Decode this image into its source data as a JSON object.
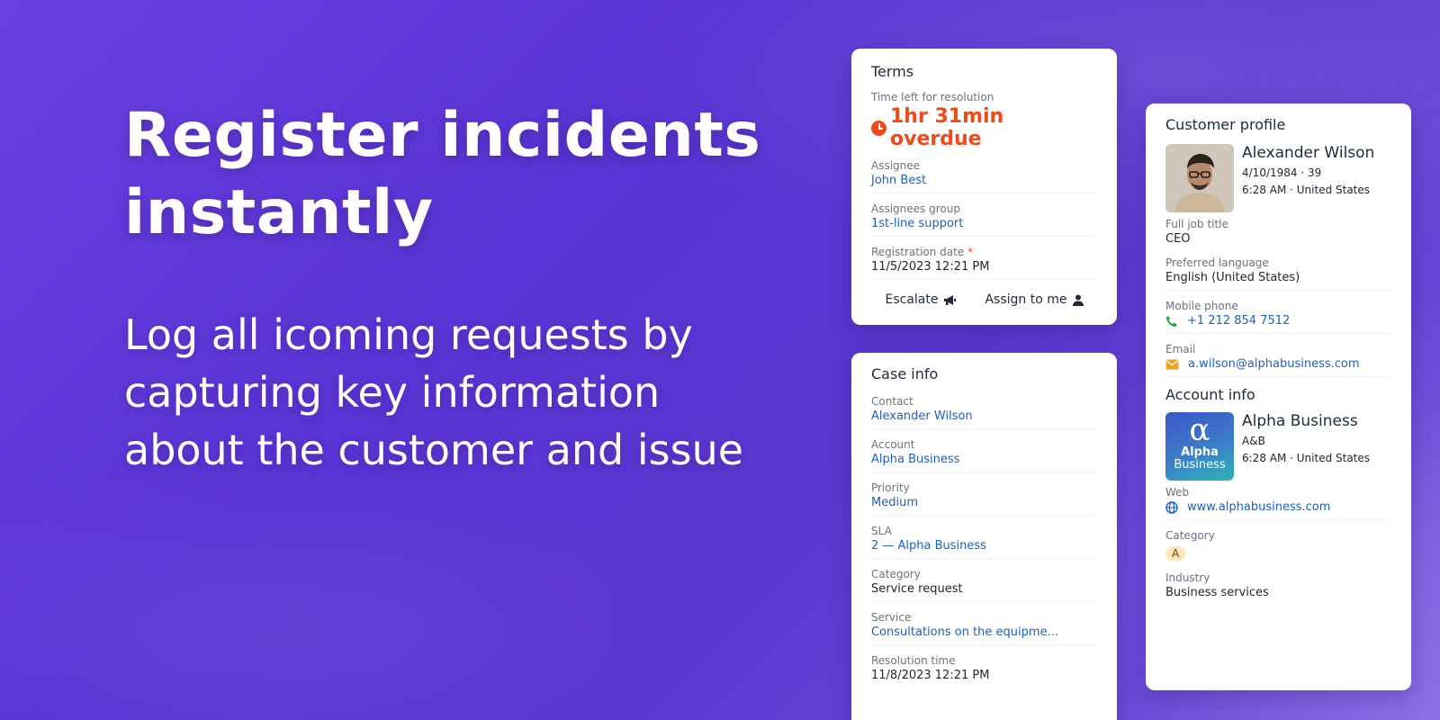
{
  "hero": {
    "title_line1": "Register incidents",
    "title_line2": "instantly",
    "subtitle_line1": "Log all icoming requests by",
    "subtitle_line2": "capturing key information",
    "subtitle_line3": "about the customer and issue"
  },
  "terms": {
    "title": "Terms",
    "time_left_label": "Time left for resolution",
    "time_left_value": "1hr 31min overdue",
    "assignee_label": "Assignee",
    "assignee_value": "John Best",
    "group_label": "Assignees group",
    "group_value": "1st-line support",
    "registration_label": "Registration date",
    "registration_required": "*",
    "registration_value": "11/5/2023 12:21 PM",
    "escalate_label": "Escalate",
    "assign_label": "Assign to me"
  },
  "case_info": {
    "title": "Case info",
    "fields": [
      {
        "label": "Contact",
        "value": "Alexander Wilson"
      },
      {
        "label": "Account",
        "value": "Alpha Business"
      },
      {
        "label": "Priority",
        "value": "Medium"
      },
      {
        "label": "SLA",
        "value": "2 — Alpha Business"
      },
      {
        "label": "Category",
        "value": "Service request"
      },
      {
        "label": "Service",
        "value": "Consultations on the equipme..."
      },
      {
        "label": "Resolution time",
        "value": "11/8/2023 12:21 PM"
      }
    ]
  },
  "customer_profile": {
    "title": "Customer profile",
    "name": "Alexander Wilson",
    "birth": "4/10/1984 · 39",
    "local": "6:28 AM · United States",
    "job_label": "Full job title",
    "job_value": "CEO",
    "lang_label": "Preferred language",
    "lang_value": "English (United States)",
    "phone_label": "Mobile phone",
    "phone_value": "+1 212 854 7512",
    "email_label": "Email",
    "email_value": "a.wilson@alphabusiness.com"
  },
  "account_info": {
    "title": "Account info",
    "name": "Alpha Business",
    "code": "A&B",
    "local": "6:28 AM · United States",
    "logo_symbol": "α",
    "logo_line1": "Alpha",
    "logo_line2": "Business",
    "web_label": "Web",
    "web_value": "www.alphabusiness.com",
    "category_label": "Category",
    "category_value": "A",
    "industry_label": "Industry",
    "industry_value": "Business services"
  },
  "colors": {
    "accent_link": "#1a5fd1",
    "overdue": "#f04a1b",
    "phone_icon": "#22a447",
    "email_icon": "#f2a31b"
  }
}
